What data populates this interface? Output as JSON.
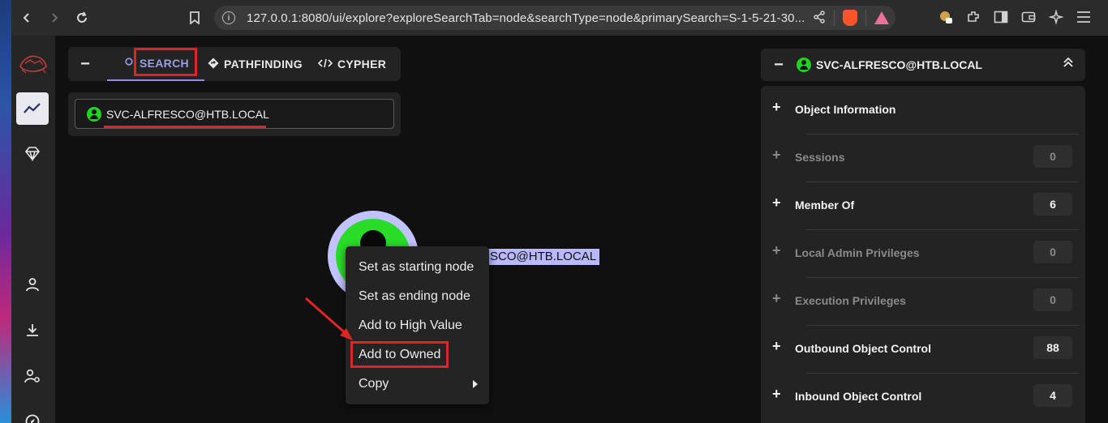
{
  "browser": {
    "url": "127.0.0.1:8080/ui/explore?exploreSearchTab=node&searchType=node&primarySearch=S-1-5-21-30..."
  },
  "sidebar": {
    "items": [
      {
        "name": "logo"
      },
      {
        "name": "explore",
        "icon": "graph-trend-icon",
        "active": true
      },
      {
        "name": "group-management",
        "icon": "gem-icon"
      },
      {
        "name": "my-profile",
        "icon": "user-icon"
      },
      {
        "name": "download-collectors",
        "icon": "download-icon"
      },
      {
        "name": "administration",
        "icon": "user-cog-icon"
      },
      {
        "name": "api-explorer",
        "icon": "compass-icon"
      }
    ]
  },
  "search_panel": {
    "collapse": "−",
    "tabs": [
      "SEARCH",
      "PATHFINDING",
      "CYPHER"
    ],
    "active_tab": "SEARCH",
    "search_value": "SVC-ALFRESCO@HTB.LOCAL"
  },
  "graph": {
    "node_label": "SCO@HTB.LOCAL",
    "node_color": "#28dc28",
    "selection_color": "#b9b9ff"
  },
  "context_menu": {
    "items": [
      "Set as starting node",
      "Set as ending node",
      "Add to High Value",
      "Add to Owned",
      "Copy"
    ]
  },
  "entity_panel": {
    "collapse": "−",
    "title": "SVC-ALFRESCO@HTB.LOCAL",
    "sections": [
      {
        "label": "Object Information",
        "count": "",
        "enabled": true
      },
      {
        "label": "Sessions",
        "count": "0",
        "enabled": false
      },
      {
        "label": "Member Of",
        "count": "6",
        "enabled": true
      },
      {
        "label": "Local Admin Privileges",
        "count": "0",
        "enabled": false
      },
      {
        "label": "Execution Privileges",
        "count": "0",
        "enabled": false
      },
      {
        "label": "Outbound Object Control",
        "count": "88",
        "enabled": true
      },
      {
        "label": "Inbound Object Control",
        "count": "4",
        "enabled": true
      }
    ]
  },
  "colors": {
    "accent": "#9c9ce8",
    "highlight": "#e02424",
    "user_node": "#1fd41f"
  }
}
